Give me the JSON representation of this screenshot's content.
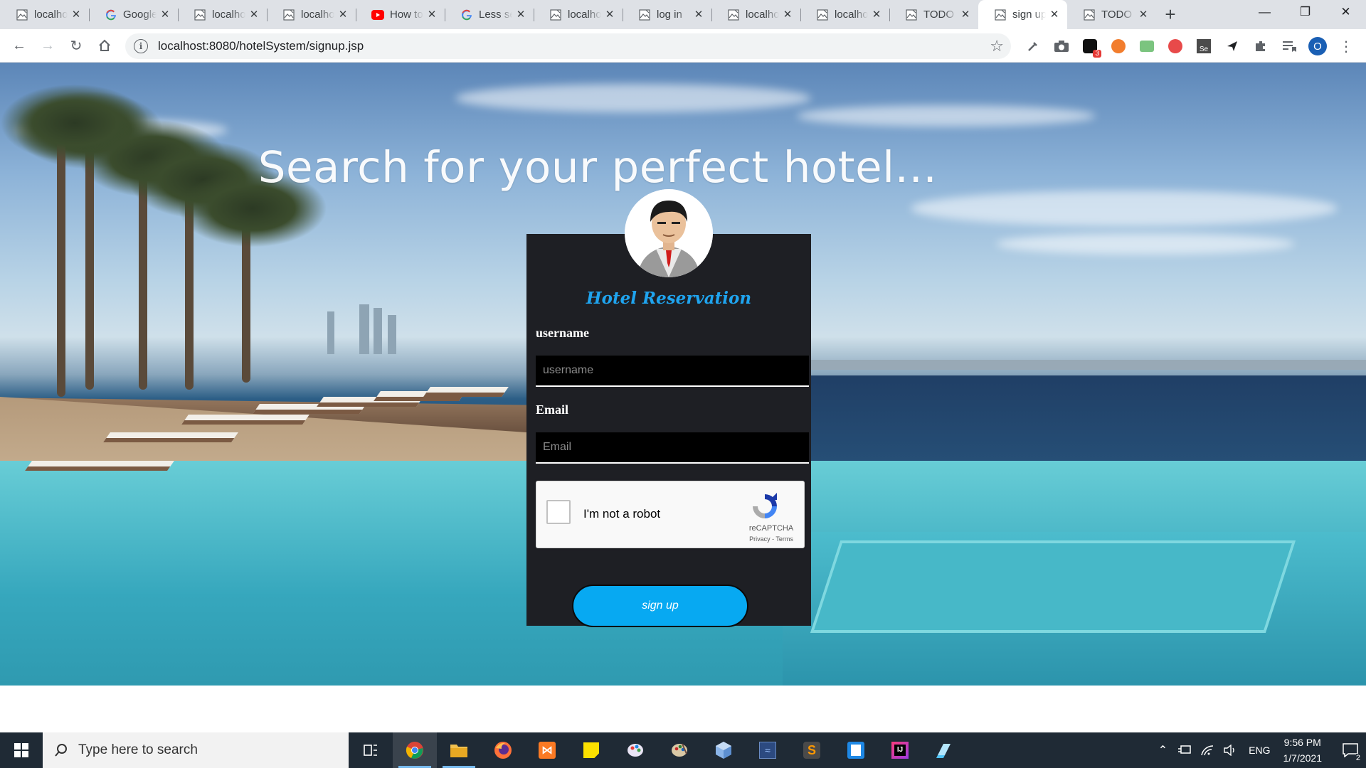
{
  "browser": {
    "tabs": [
      {
        "title": "localhost",
        "favicon": "broken-image-icon",
        "active": false
      },
      {
        "title": "Google",
        "favicon": "google-icon",
        "active": false
      },
      {
        "title": "localhost",
        "favicon": "broken-image-icon",
        "active": false
      },
      {
        "title": "localhost",
        "favicon": "broken-image-icon",
        "active": false
      },
      {
        "title": "How to",
        "favicon": "youtube-icon",
        "active": false
      },
      {
        "title": "Less se",
        "favicon": "google-icon",
        "active": false
      },
      {
        "title": "localhost",
        "favicon": "broken-image-icon",
        "active": false
      },
      {
        "title": "log in",
        "favicon": "broken-image-icon",
        "active": false
      },
      {
        "title": "localhost",
        "favicon": "broken-image-icon",
        "active": false
      },
      {
        "title": "localhost",
        "favicon": "broken-image-icon",
        "active": false
      },
      {
        "title": "TODO",
        "favicon": "broken-image-icon",
        "active": false
      },
      {
        "title": "sign up",
        "favicon": "broken-image-icon",
        "active": true
      },
      {
        "title": "TODO",
        "favicon": "broken-image-icon",
        "active": false
      }
    ],
    "address_bar": {
      "url": "localhost:8080/hotelSystem/signup.jsp"
    },
    "profile_initial": "O",
    "extension_badge": "3"
  },
  "page": {
    "headline": "Search for your perfect hotel...",
    "brand_title": "Hotel Reservation",
    "form": {
      "username_label": "username",
      "username_placeholder": "username",
      "email_label": "Email",
      "email_placeholder": "Email",
      "captcha_text": "I'm not a robot",
      "captcha_brand": "reCAPTCHA",
      "captcha_links": "Privacy - Terms",
      "submit_label": "sign up"
    }
  },
  "taskbar": {
    "search_placeholder": "Type here to search",
    "language": "ENG",
    "time": "9:56 PM",
    "date": "1/7/2021",
    "notification_count": "2"
  },
  "colors": {
    "card_bg": "#1e1f24",
    "brand_blue": "#1fa4ef",
    "button_blue": "#07a9f2",
    "taskbar": "#1f2a35"
  }
}
